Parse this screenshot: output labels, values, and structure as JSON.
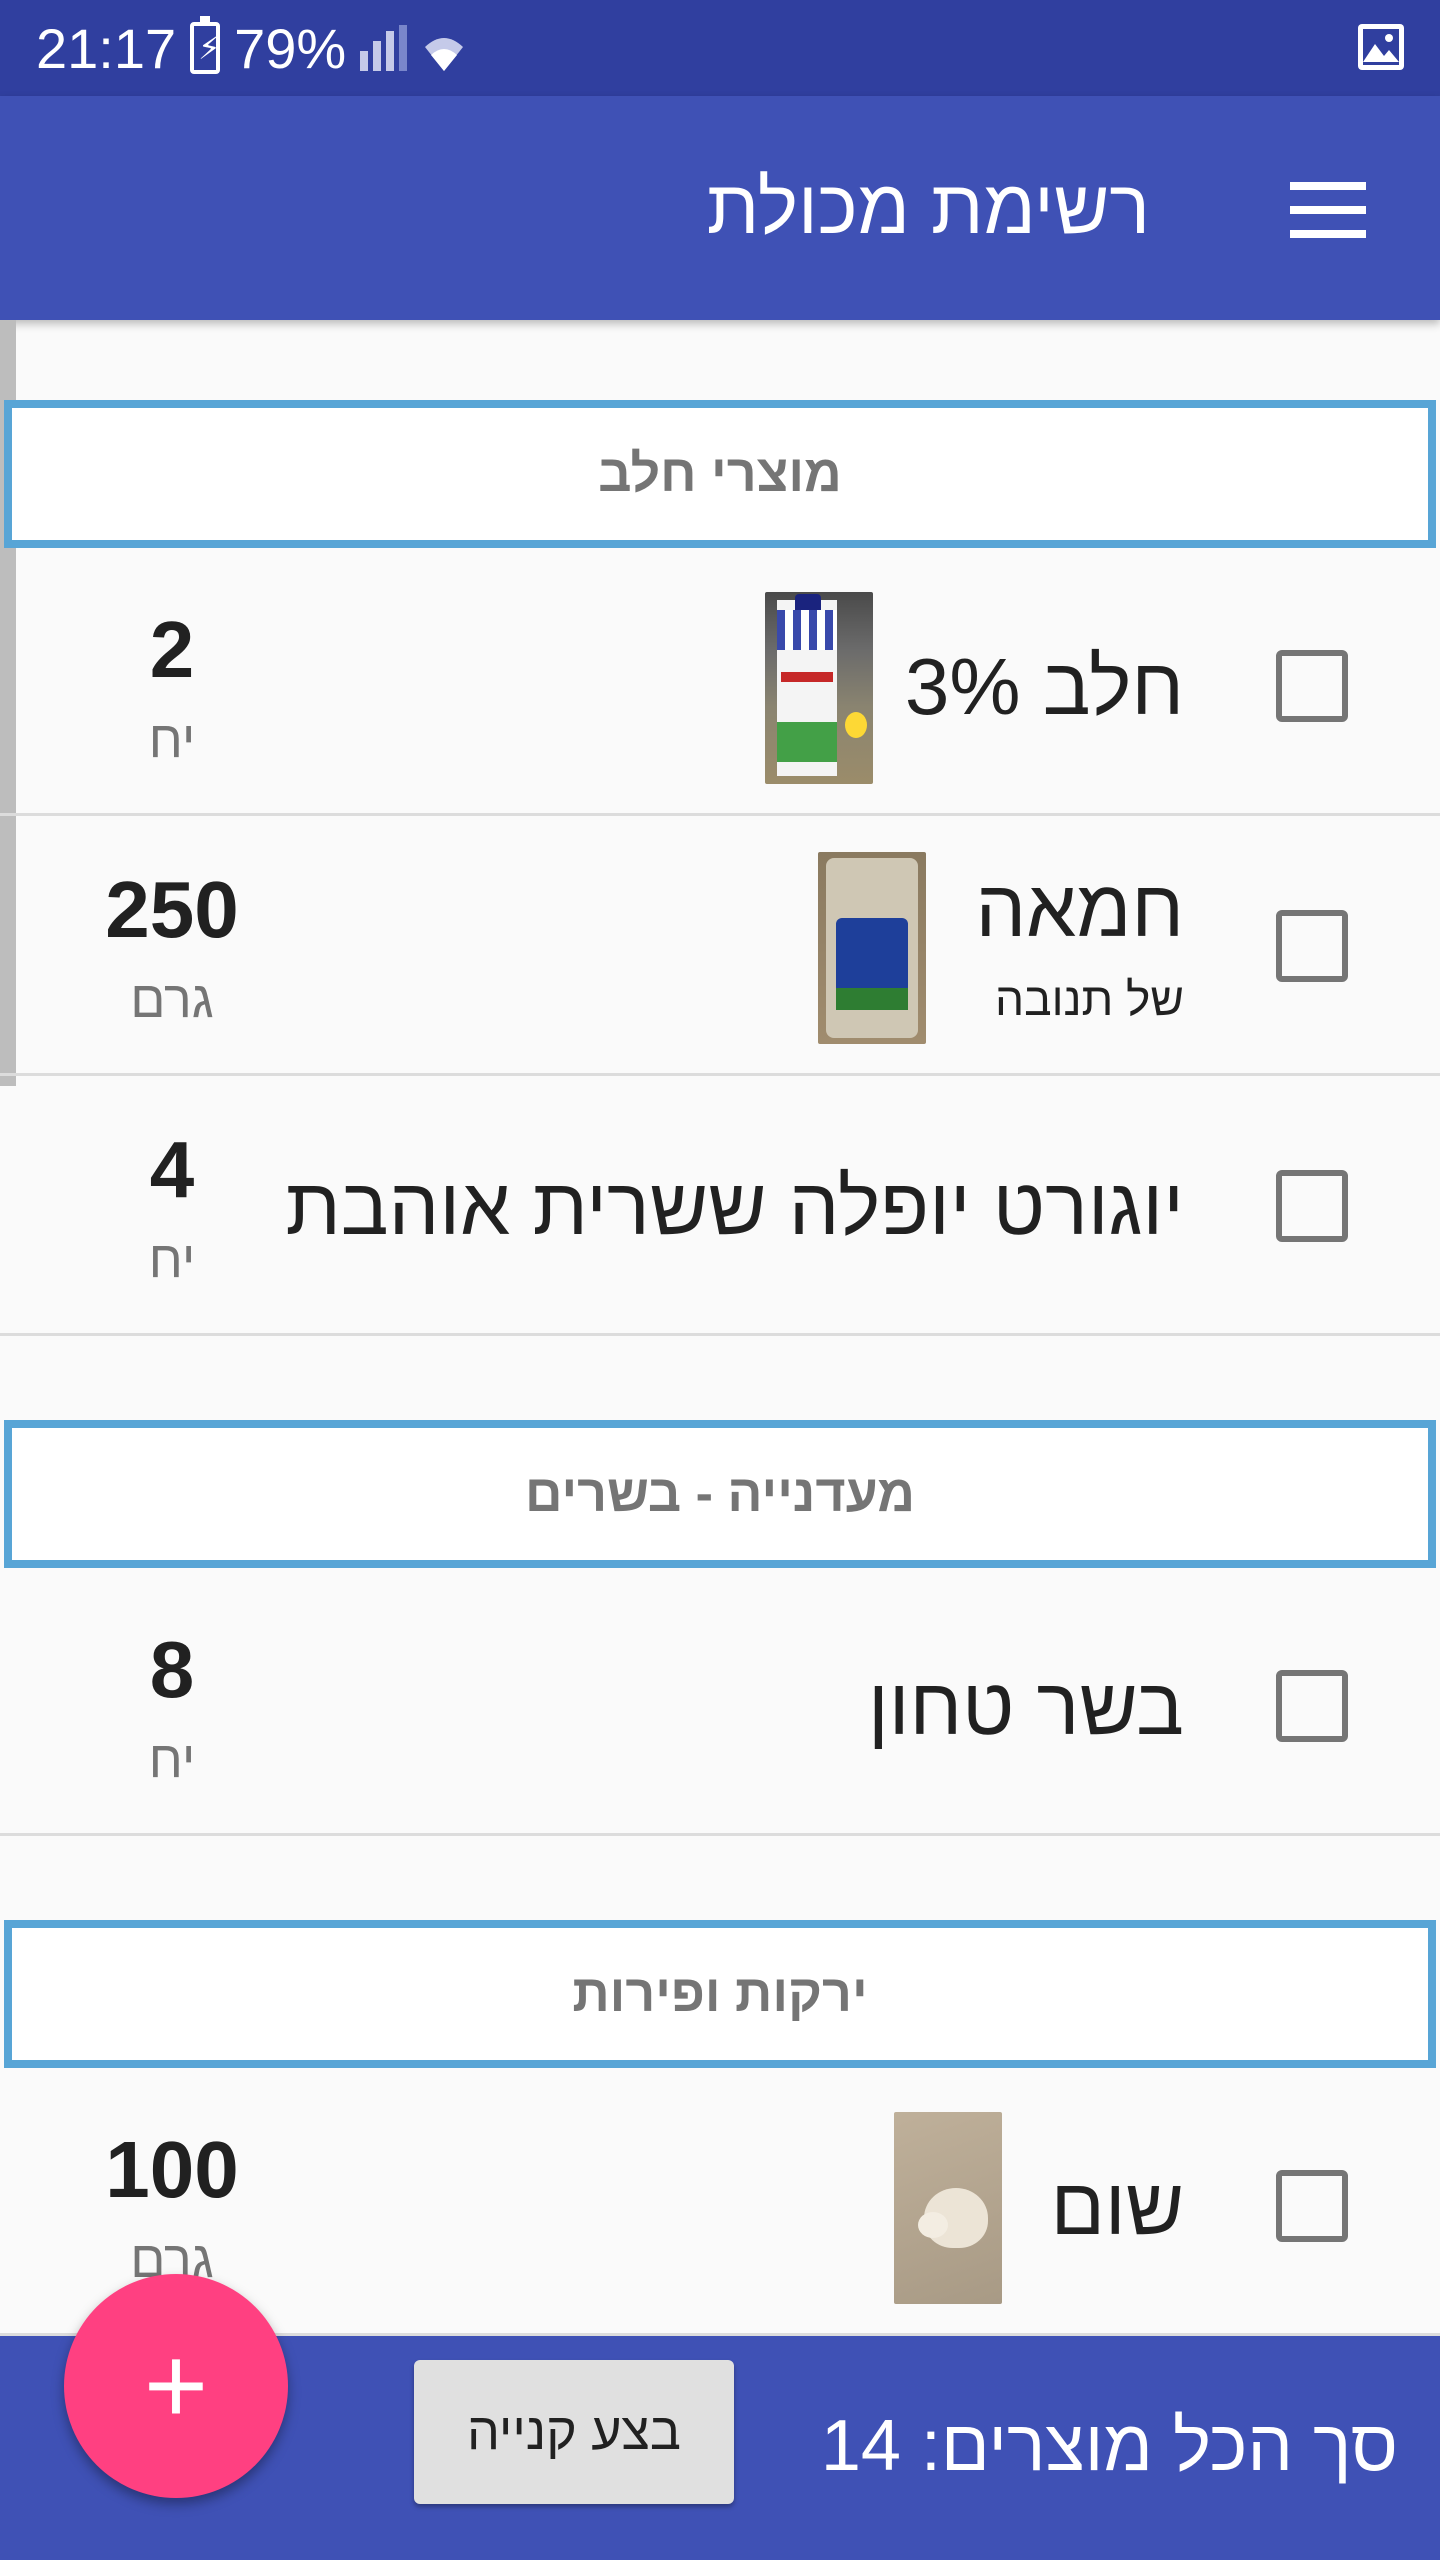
{
  "status_bar": {
    "time": "21:17",
    "battery": "79%",
    "icons": [
      "battery-charging-icon",
      "signal-icon",
      "wifi-icon",
      "image-notification-icon"
    ]
  },
  "app_bar": {
    "title": "רשימת מכולת",
    "menu_icon": "hamburger-menu-icon"
  },
  "sections": [
    {
      "label": "מוצרי חלב",
      "items": [
        {
          "name": "חלב 3%",
          "sub": "",
          "qty": "2",
          "unit": "יח",
          "checked": false,
          "has_image": true
        },
        {
          "name": "חמאה",
          "sub": "של תנובה",
          "qty": "250",
          "unit": "גרם",
          "checked": false,
          "has_image": true
        },
        {
          "name": "יוגורט יופלה ששרית אוהבת",
          "sub": "",
          "qty": "4",
          "unit": "יח",
          "checked": false,
          "has_image": false
        }
      ]
    },
    {
      "label": "מעדנייה - בשרים",
      "items": [
        {
          "name": "בשר טחון",
          "sub": "",
          "qty": "8",
          "unit": "יח",
          "checked": false,
          "has_image": false
        }
      ]
    },
    {
      "label": "ירקות ופירות",
      "items": [
        {
          "name": "שום",
          "sub": "",
          "qty": "100",
          "unit": "גרם",
          "checked": false,
          "has_image": true
        }
      ]
    }
  ],
  "bottom_bar": {
    "total_label": "סך הכל מוצרים: 14",
    "buy_button": "בצע קנייה"
  },
  "fab": {
    "label": "+",
    "icon": "add-icon"
  },
  "colors": {
    "status_bar": "#303f9f",
    "primary": "#3f51b5",
    "accent": "#ff4081",
    "section_border": "#58a5d6"
  }
}
